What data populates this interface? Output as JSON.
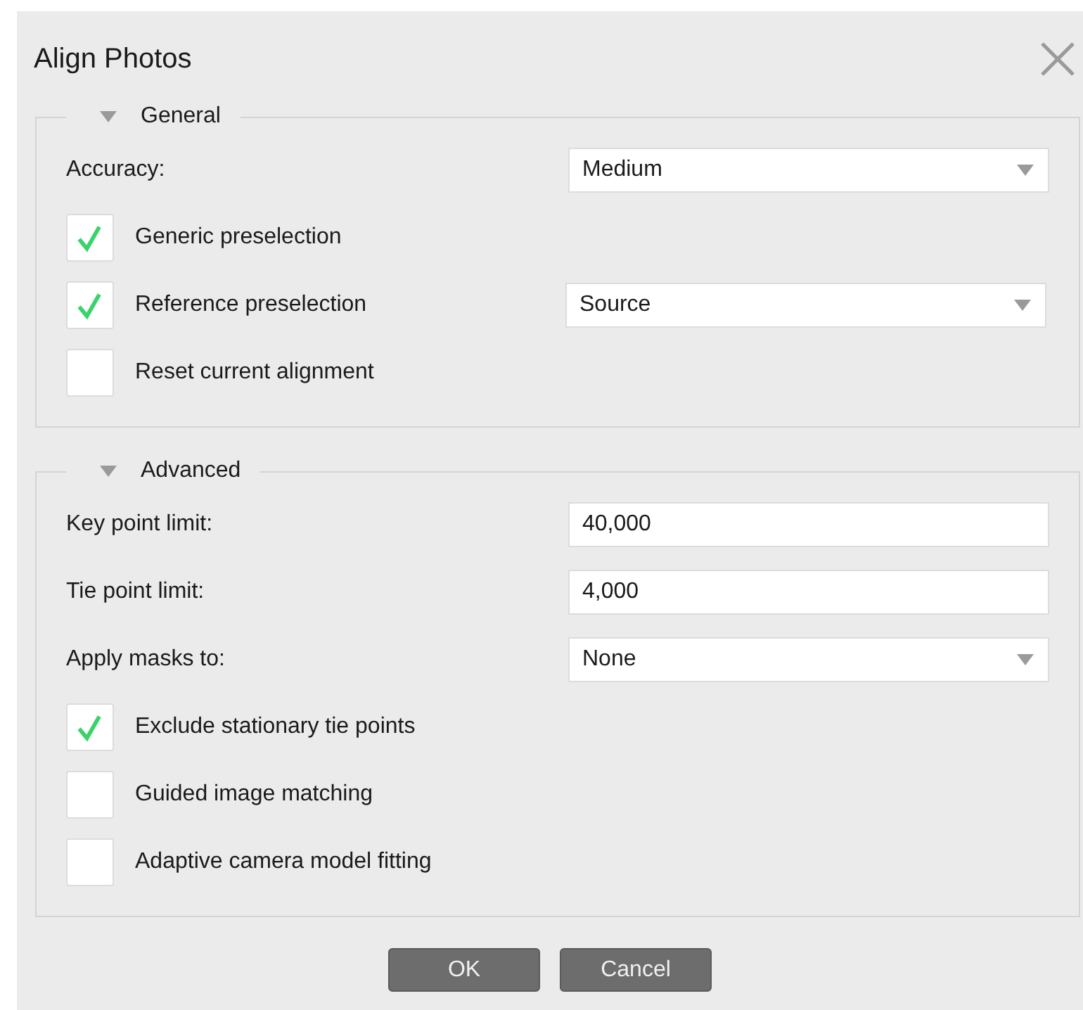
{
  "window": {
    "title": "Align Photos"
  },
  "sections": [
    {
      "title": "General",
      "expanded": true,
      "rows": [
        {
          "kind": "dropdown",
          "label": "Accuracy:",
          "value": "Medium"
        },
        {
          "kind": "checkbox",
          "label": "Generic preselection",
          "checked": true
        },
        {
          "kind": "checkbox",
          "label": "Reference preselection",
          "checked": true,
          "value": "Source"
        },
        {
          "kind": "checkbox",
          "label": "Reset current alignment",
          "checked": false
        }
      ]
    },
    {
      "title": "Advanced",
      "expanded": true,
      "rows": [
        {
          "kind": "field",
          "label": "Key point limit:",
          "value": "40,000"
        },
        {
          "kind": "field",
          "label": "Tie point limit:",
          "value": "4,000"
        },
        {
          "kind": "dropdown",
          "label": "Apply masks to:",
          "value": "None"
        },
        {
          "kind": "checkbox",
          "label": "Exclude stationary tie points",
          "checked": true
        },
        {
          "kind": "checkbox",
          "label": "Guided image matching",
          "checked": false
        },
        {
          "kind": "checkbox",
          "label": "Adaptive camera model fitting",
          "checked": false
        }
      ]
    }
  ],
  "buttons": [
    "OK",
    "Cancel"
  ]
}
